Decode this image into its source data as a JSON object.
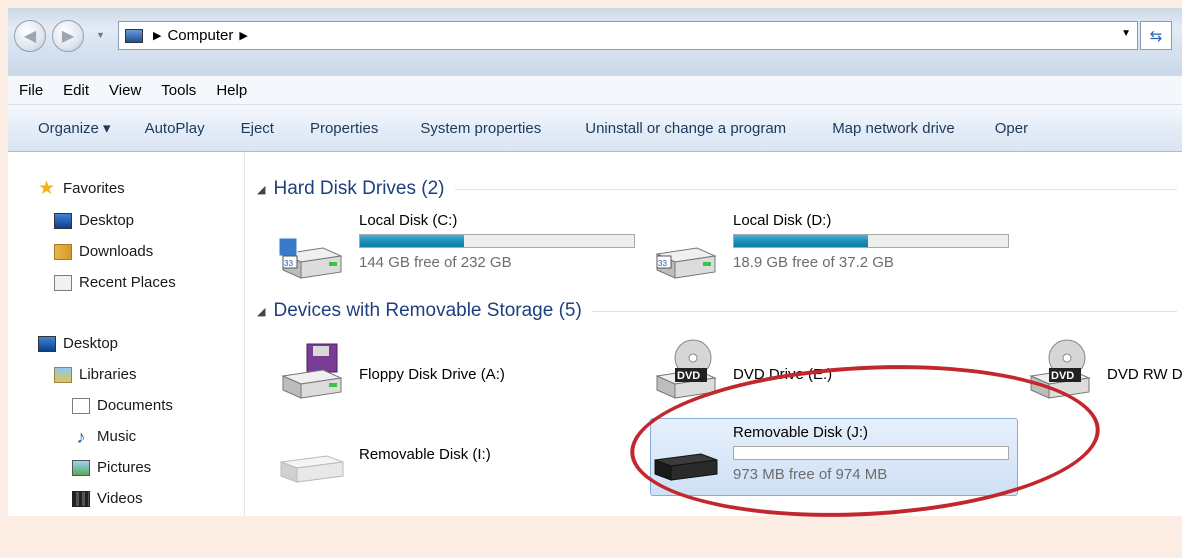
{
  "address": {
    "path_label": "Computer"
  },
  "menu": [
    "File",
    "Edit",
    "View",
    "Tools",
    "Help"
  ],
  "toolbar": {
    "organize": "Organize ▾",
    "autoplay": "AutoPlay",
    "eject": "Eject",
    "properties": "Properties",
    "system_properties": "System properties",
    "uninstall": "Uninstall or change a program",
    "map_network": "Map network drive",
    "open": "Oper"
  },
  "sidebar": {
    "favorites": {
      "title": "Favorites",
      "items": [
        "Desktop",
        "Downloads",
        "Recent Places"
      ]
    },
    "desktop": "Desktop",
    "libraries": {
      "title": "Libraries",
      "items": [
        "Documents",
        "Music",
        "Pictures",
        "Videos"
      ]
    }
  },
  "groups": {
    "hard_disks": "Hard Disk Drives (2)",
    "removable": "Devices with Removable Storage (5)"
  },
  "drives": {
    "c": {
      "name": "Local Disk (C:)",
      "free": "144 GB free of 232 GB",
      "used_fraction": 0.38
    },
    "d": {
      "name": "Local Disk (D:)",
      "free": "18.9 GB free of 37.2 GB",
      "used_fraction": 0.49
    },
    "a": {
      "name": "Floppy Disk Drive (A:)"
    },
    "e": {
      "name": "DVD Drive (E:)"
    },
    "dvdrw": {
      "name": "DVD RW D"
    },
    "i": {
      "name": "Removable Disk (I:)"
    },
    "j": {
      "name": "Removable Disk (J:)",
      "free": "973 MB free of 974 MB",
      "used_fraction": 0.001
    }
  },
  "dvd_badge": "DVD",
  "colors": {
    "annotation": "#c2272d",
    "selection": "#cfe0f5"
  }
}
